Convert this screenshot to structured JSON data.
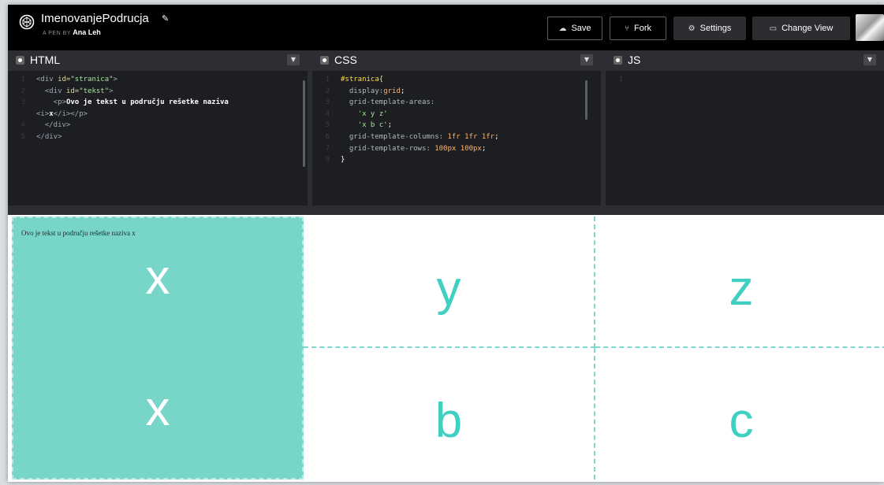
{
  "header": {
    "title": "ImenovanjePodrucja",
    "byline_prefix": "A PEN BY",
    "author": "Ana Leh",
    "buttons": {
      "save": "Save",
      "fork": "Fork",
      "settings": "Settings",
      "change_view": "Change View"
    }
  },
  "editors": {
    "html": {
      "name": "HTML",
      "lines": [
        {
          "n": "1",
          "t1": "<div ",
          "a1": "id=",
          "s1": "\"stranica\"",
          "t2": ">"
        },
        {
          "n": "2",
          "t1": "  <div ",
          "a1": "id=",
          "s1": "\"tekst\"",
          "t2": ">"
        },
        {
          "n": "3",
          "t1": "    <p>",
          "txt": "Ovo je tekst u području rešetke naziva"
        },
        {
          "n": "",
          "t1": "<i>",
          "txt": "x",
          "t2": "</i></p>"
        },
        {
          "n": "4",
          "t1": "  </div>"
        },
        {
          "n": "5",
          "t1": "</div>"
        }
      ]
    },
    "css": {
      "name": "CSS",
      "lines": [
        {
          "n": "1",
          "sel": "#stranica{"
        },
        {
          "n": "2",
          "prop": "  display:",
          "val": "grid",
          "end": ";"
        },
        {
          "n": "3",
          "prop": "  grid-template-areas:"
        },
        {
          "n": "4",
          "str": "    'x y z'"
        },
        {
          "n": "5",
          "str": "    'x b c'",
          "end": ";"
        },
        {
          "n": "6",
          "prop": "  grid-template-columns: ",
          "val": "1fr 1fr 1fr",
          "end": ";"
        },
        {
          "n": "7",
          "prop": "  grid-template-rows: ",
          "val": "100px 100px",
          "end": ";"
        },
        {
          "n": "8",
          "brace": "}"
        }
      ]
    },
    "js": {
      "name": "JS",
      "lines": [
        {
          "n": "1"
        }
      ]
    }
  },
  "preview": {
    "paragraph": "Ovo je tekst u području rešetke naziva x",
    "areas": {
      "x_top": "x",
      "x_bottom": "x",
      "y": "y",
      "z": "z",
      "b": "b",
      "c": "c"
    }
  },
  "colors": {
    "accent": "#3fd0c2",
    "area_x_bg": "#78d6c9",
    "header_bg": "#000000",
    "editor_bg": "#1d1e22"
  }
}
